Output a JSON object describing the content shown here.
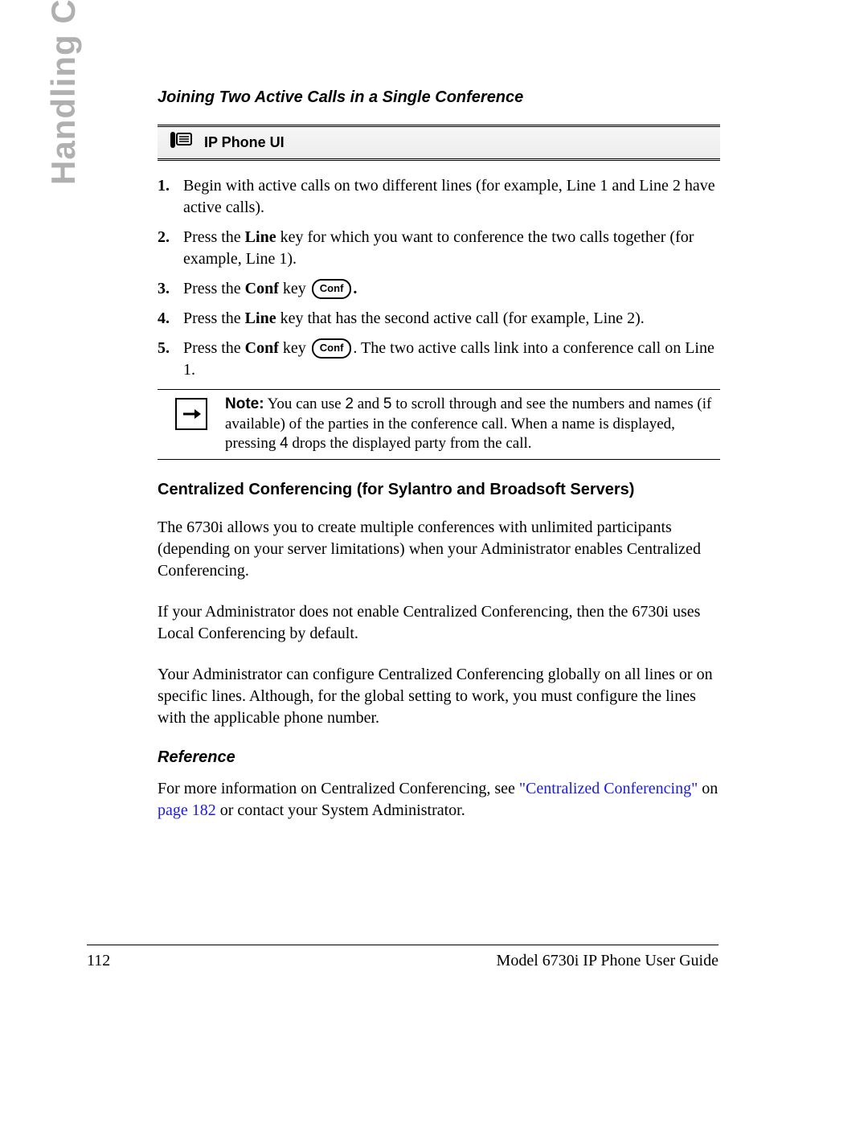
{
  "sidebar_label": "Handling Calls",
  "section_title": "Joining Two Active Calls in a Single Conference",
  "ipui_label": "IP Phone UI",
  "conf_key_label": "Conf",
  "steps": {
    "s1": "Begin with active calls on two different lines (for example, Line 1 and Line 2 have active calls).",
    "s2_a": "Press the ",
    "s2_b": "Line",
    "s2_c": " key for which you want to conference the two calls together (for example, Line 1).",
    "s3_a": "Press the ",
    "s3_b": "Conf",
    "s3_c": " key ",
    "s4_a": "Press the ",
    "s4_b": "Line",
    "s4_c": " key that has the second active call (for example, Line 2).",
    "s5_a": "Press the ",
    "s5_b": "Conf",
    "s5_c": " key ",
    "s5_d": ". The two active calls link into a conference call on Line 1."
  },
  "note": {
    "label": "Note:",
    "a": " You can use ",
    "k1": "2",
    "b": " and ",
    "k2": "5",
    "c": " to scroll through and see the numbers and names (if available) of the parties in the conference call. When a name is displayed, pressing ",
    "k3": "4",
    "d": " drops the displayed party from the call."
  },
  "central_heading": "Centralized Conferencing (for Sylantro and Broadsoft Servers)",
  "central_p1": "The 6730i allows you to create multiple conferences with unlimited participants (depending on your server limitations) when your Administrator enables Centralized Conferencing.",
  "central_p2": "If your Administrator does not enable Centralized Conferencing, then the 6730i uses Local Conferencing by default.",
  "central_p3": "Your Administrator can configure Centralized Conferencing globally on all lines or on specific lines. Although, for the global setting to work, you must configure the lines with the applicable phone number.",
  "reference_heading": "Reference",
  "reference": {
    "a": "For more information on Centralized Conferencing, see ",
    "link1": "\"Centralized Conferencing\"",
    "b": " on ",
    "link2": "page 182",
    "c": " or contact your System Administrator."
  },
  "footer": {
    "page_no": "112",
    "doc_title": "Model 6730i IP Phone User Guide"
  }
}
